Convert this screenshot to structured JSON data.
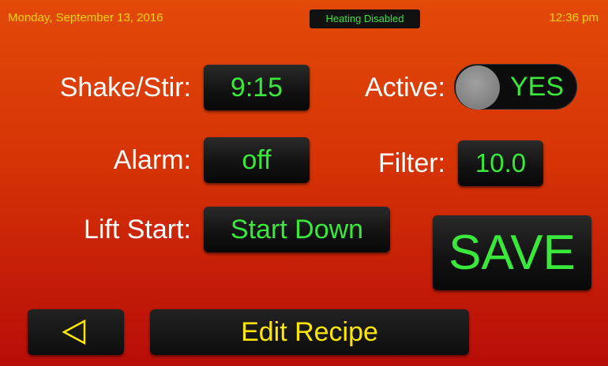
{
  "status_bar": {
    "date": "Monday, September 13, 2016",
    "heating_status": "Heating Disabled",
    "time": "12:36 pm"
  },
  "fields": {
    "shake_stir": {
      "label": "Shake/Stir:",
      "value": "9:15"
    },
    "active": {
      "label": "Active:",
      "value": "YES"
    },
    "alarm": {
      "label": "Alarm:",
      "value": "off"
    },
    "filter": {
      "label": "Filter:",
      "value": "10.0"
    },
    "lift_start": {
      "label": "Lift Start:",
      "value": "Start Down"
    }
  },
  "buttons": {
    "save_label": "SAVE",
    "back_icon": "back-triangle-icon",
    "title": "Edit Recipe"
  },
  "colors": {
    "accent_green": "#39e83a",
    "title_yellow": "#ffe600",
    "status_yellow": "#ffd400",
    "background_top": "#e24a08",
    "background_bottom": "#b80d08"
  }
}
